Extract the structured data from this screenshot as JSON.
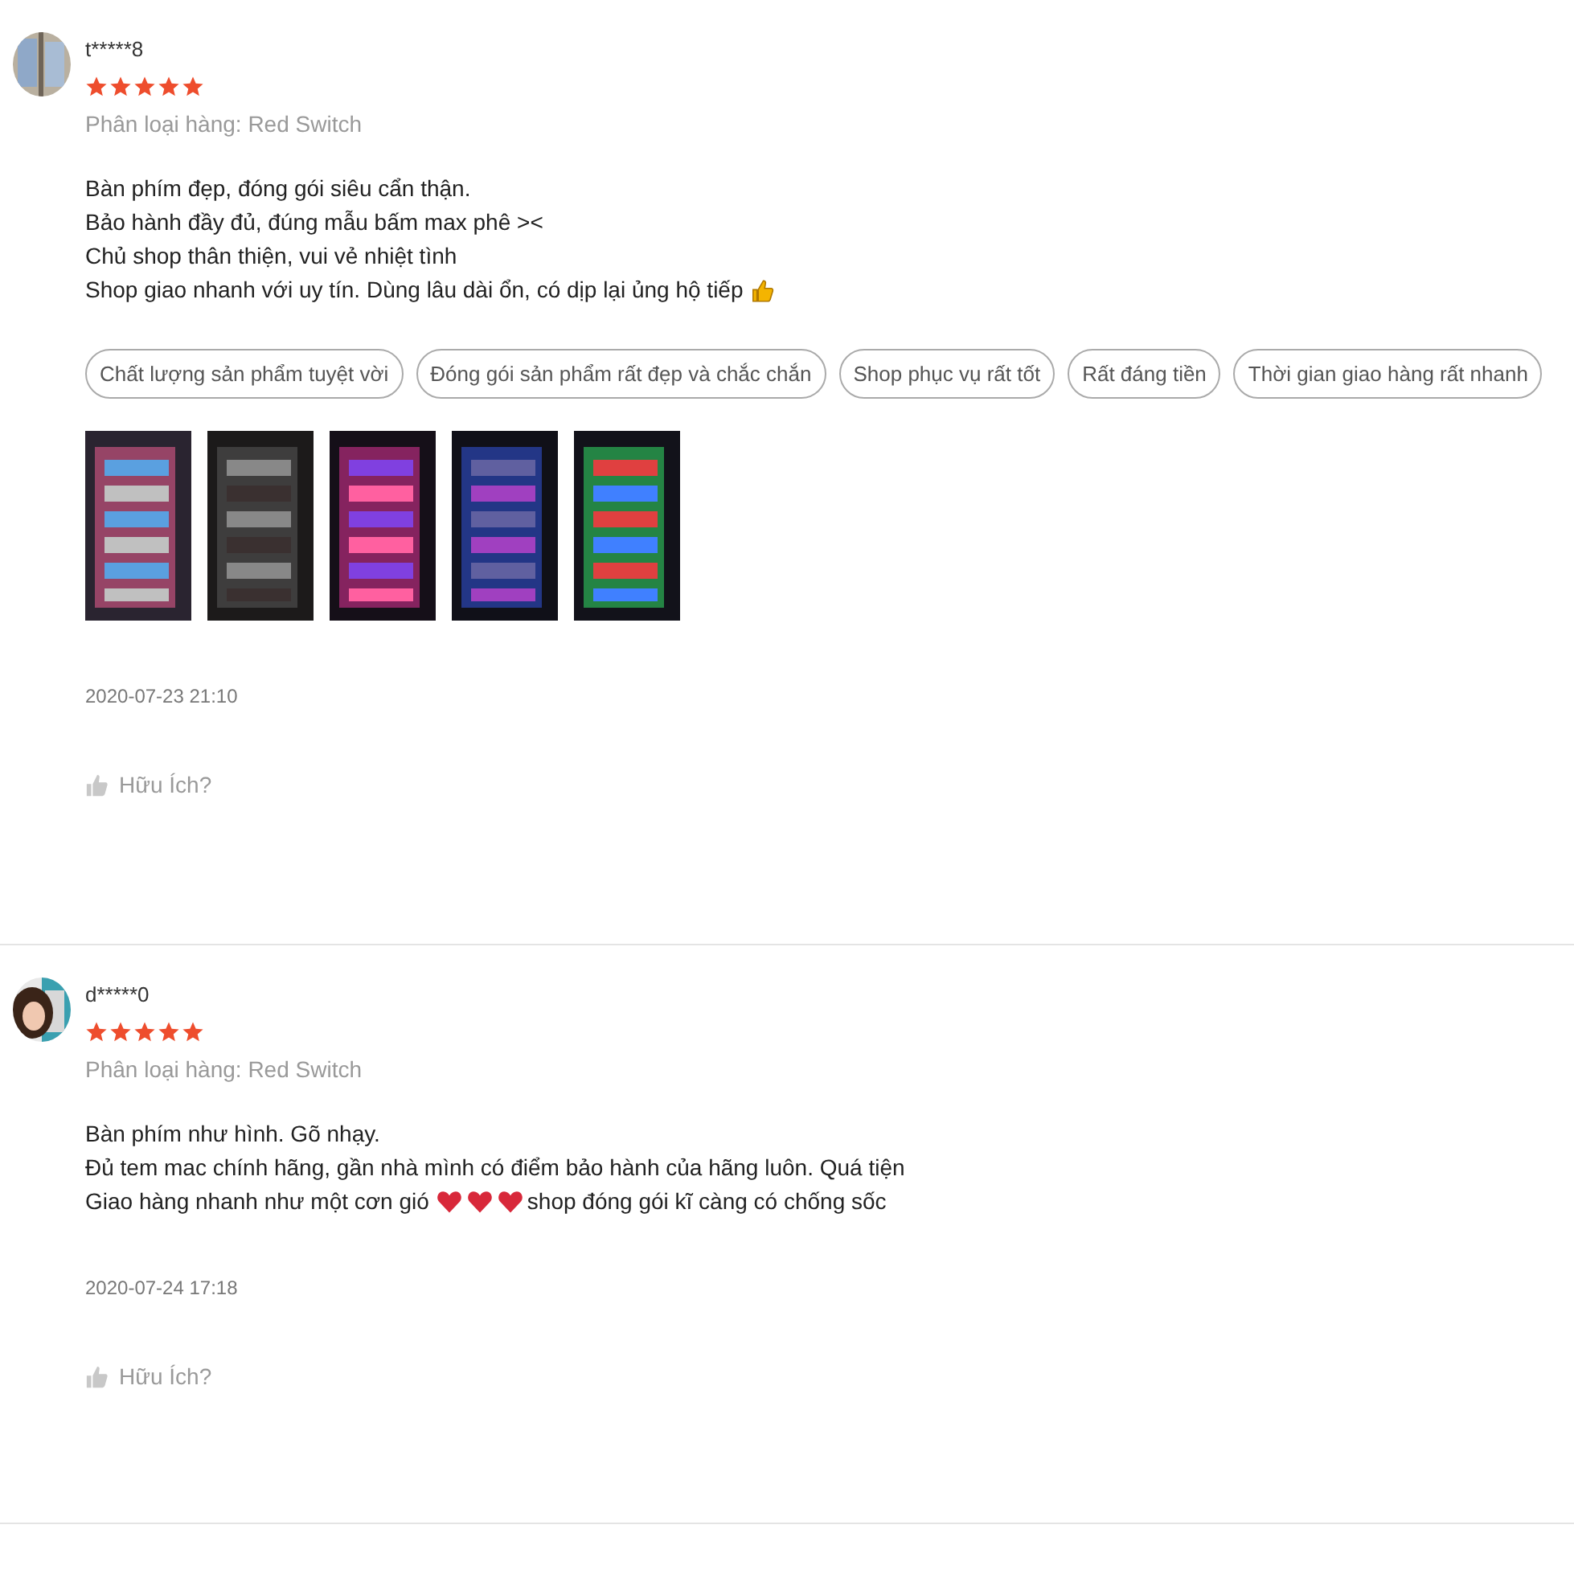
{
  "reviews": [
    {
      "username": "t*****8",
      "stars": 5,
      "variant": "Phân loại hàng: Red Switch",
      "comment": [
        [
          {
            "kind": "text",
            "text": "Bàn phím đẹp, đóng gói siêu cẩn thận."
          }
        ],
        [
          {
            "kind": "text",
            "text": "Bảo hành đầy đủ, đúng mẫu bấm max phê ><"
          }
        ],
        [
          {
            "kind": "text",
            "text": "Chủ shop thân thiện, vui vẻ nhiệt tình"
          }
        ],
        [
          {
            "kind": "text",
            "text": "Shop giao nhanh với uy tín. Dùng lâu dài ổn, có dịp lại ủng hộ tiếp"
          },
          {
            "kind": "thumb"
          }
        ]
      ],
      "tags": [
        "Chất lượng sản phẩm tuyệt vời",
        "Đóng gói sản phẩm rất đẹp và chắc chắn",
        "Shop phục vụ rất tốt",
        "Rất đáng tiền",
        "Thời gian giao hàng rất nhanh"
      ],
      "photos": [
        {
          "kind": "picture"
        },
        {
          "kind": "picture"
        },
        {
          "kind": "picture"
        },
        {
          "kind": "picture"
        },
        {
          "kind": "picture"
        }
      ],
      "date": "2020-07-23 21:10",
      "helpful": "Hữu Ích?"
    },
    {
      "username": "d*****0",
      "stars": 5,
      "variant": "Phân loại hàng: Red Switch",
      "comment": [
        [
          {
            "kind": "text",
            "text": "Bàn phím như hình. Gõ nhạy."
          }
        ],
        [
          {
            "kind": "text",
            "text": "Đủ tem mac chính hãng, gần nhà mình có điểm bảo hành của hãng luôn. Quá tiện"
          }
        ],
        [
          {
            "kind": "text",
            "text": "Giao hàng nhanh như một cơn gió"
          },
          {
            "kind": "heart"
          },
          {
            "kind": "heart"
          },
          {
            "kind": "heart"
          },
          {
            "kind": "text",
            "text": "shop đóng gói kĩ càng có chống sốc"
          }
        ]
      ],
      "date": "2020-07-24 17:18",
      "helpful": "Hữu Ích?"
    }
  ]
}
